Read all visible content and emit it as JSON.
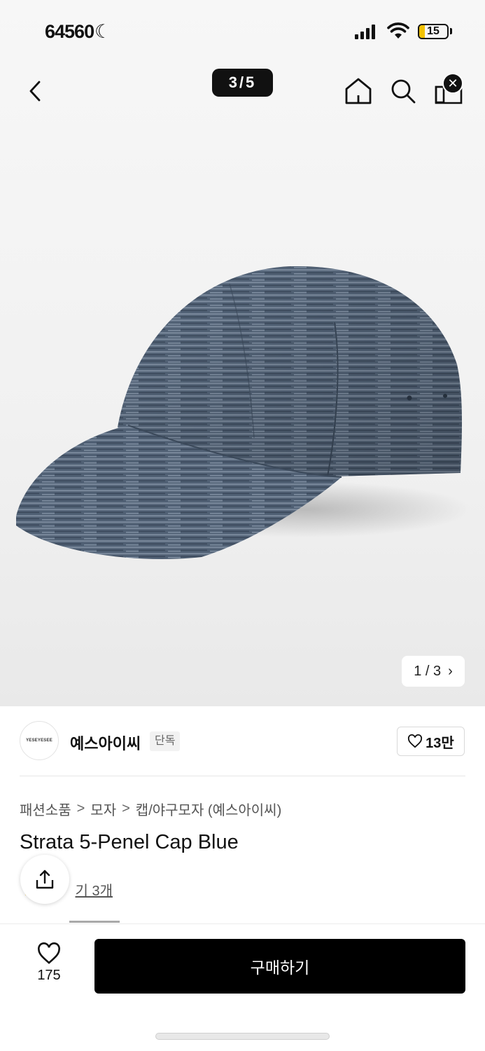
{
  "status_bar": {
    "time": "64560",
    "moon": "☾",
    "battery_level": "15"
  },
  "top_nav": {
    "image_counter": "3/5"
  },
  "product_image": {
    "alt": "Strata 5-Penel Cap Blue",
    "color": "#5a6b80"
  },
  "gallery_pager": {
    "text": "1 / 3",
    "next": "›"
  },
  "brand": {
    "logo_text": "YESEYESEE",
    "name": "예스아이씨",
    "tag": "단독",
    "likes": "13만"
  },
  "breadcrumb": {
    "items": [
      "패션소품",
      "모자",
      "캡/야구모자 (예스아이씨)"
    ],
    "separator": ">"
  },
  "product": {
    "title": "Strata 5-Penel Cap Blue",
    "review_text": "후기 3개",
    "review_visible": "기 3개"
  },
  "bottom_bar": {
    "wish_count": "175",
    "buy_label": "구매하기"
  },
  "colors": {
    "accent": "#000000",
    "hero_bg": "#f4f4f4",
    "cap": "#5a6b80"
  }
}
